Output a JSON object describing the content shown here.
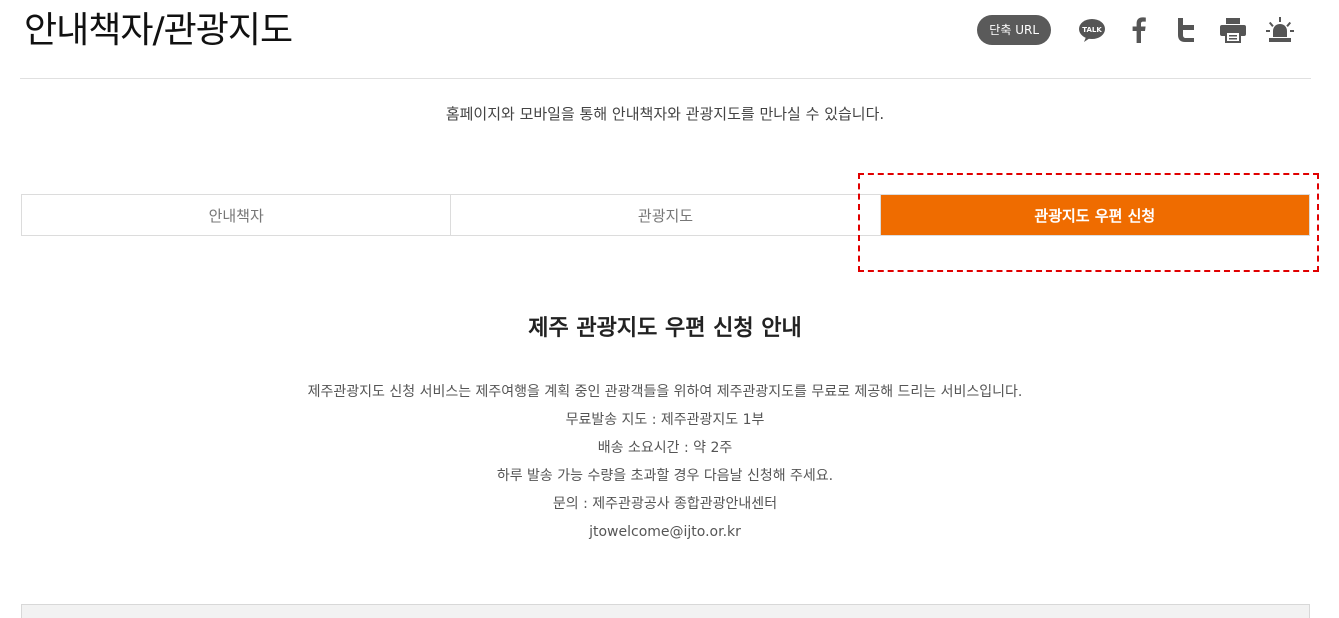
{
  "header": {
    "title": "안내책자/관광지도",
    "short_url_label": "단축 URL",
    "icons": [
      "kakaotalk-icon",
      "facebook-icon",
      "twitter-icon",
      "print-icon",
      "alarm-icon"
    ],
    "kakao_label": "TALK"
  },
  "intro": "홈페이지와 모바일을 통해 안내책자와 관광지도를 만나실 수 있습니다.",
  "tabs": [
    {
      "label": "안내책자",
      "active": false
    },
    {
      "label": "관광지도",
      "active": false
    },
    {
      "label": "관광지도 우편 신청",
      "active": true
    }
  ],
  "section": {
    "title": "제주 관광지도 우편 신청 안내",
    "lines": [
      "제주관광지도 신청 서비스는 제주여행을 계획 중인 관광객들을 위하여 제주관광지도를 무료로 제공해 드리는 서비스입니다.",
      "무료발송 지도 : 제주관광지도 1부",
      "배송 소요시간 : 약 2주",
      "하루 발송 가능 수량을 초과할 경우 다음날 신청해 주세요.",
      "문의 : 제주관광공사 종합관광안내센터",
      "jtowelcome@ijto.or.kr"
    ]
  },
  "colors": {
    "accent": "#ef6c00",
    "highlight": "#e00000",
    "button_bg": "#5a5a5a"
  }
}
